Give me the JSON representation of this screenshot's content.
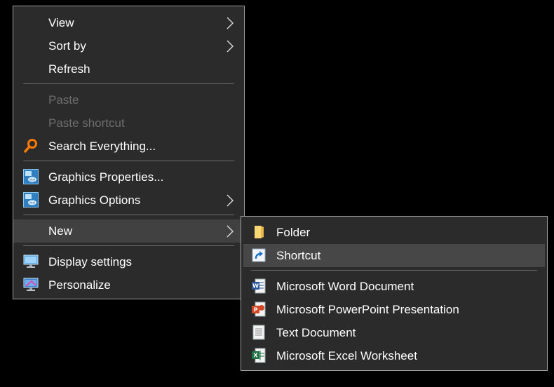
{
  "main_menu": {
    "items": [
      {
        "label": "View"
      },
      {
        "label": "Sort by"
      },
      {
        "label": "Refresh"
      },
      {
        "label": "Paste"
      },
      {
        "label": "Paste shortcut"
      },
      {
        "label": "Search Everything..."
      },
      {
        "label": "Graphics Properties..."
      },
      {
        "label": "Graphics Options"
      },
      {
        "label": "New"
      },
      {
        "label": "Display settings"
      },
      {
        "label": "Personalize"
      }
    ]
  },
  "new_submenu": {
    "items": [
      {
        "label": "Folder"
      },
      {
        "label": "Shortcut"
      },
      {
        "label": "Microsoft Word Document"
      },
      {
        "label": "Microsoft PowerPoint Presentation"
      },
      {
        "label": "Text Document"
      },
      {
        "label": "Microsoft Excel Worksheet"
      }
    ]
  },
  "colors": {
    "menu_background": "#2b2b2b",
    "highlight": "#414141",
    "disabled_text": "#6d6d6d",
    "separator": "#6a6a6a"
  }
}
